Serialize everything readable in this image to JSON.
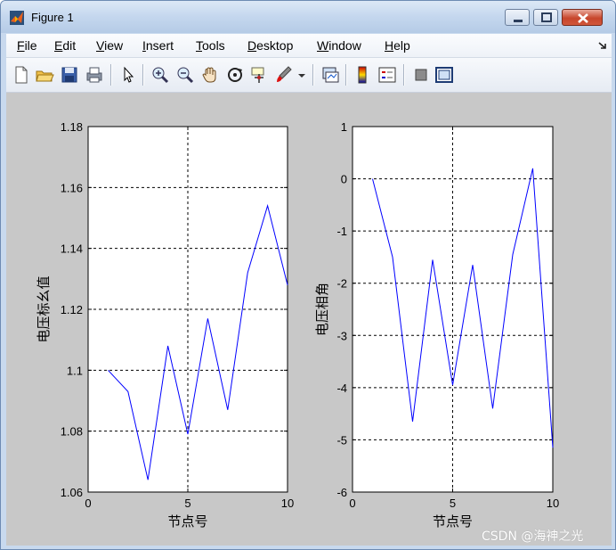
{
  "window": {
    "title": "Figure 1"
  },
  "menu": {
    "items": [
      {
        "label": "File",
        "ul": "F",
        "rest": "ile"
      },
      {
        "label": "Edit",
        "ul": "E",
        "rest": "dit"
      },
      {
        "label": "View",
        "ul": "V",
        "rest": "iew"
      },
      {
        "label": "Insert",
        "ul": "I",
        "rest": "nsert"
      },
      {
        "label": "Tools",
        "ul": "T",
        "rest": "ools"
      },
      {
        "label": "Desktop",
        "ul": "D",
        "rest": "esktop"
      },
      {
        "label": "Window",
        "ul": "W",
        "rest": "indow"
      },
      {
        "label": "Help",
        "ul": "H",
        "rest": "elp"
      }
    ]
  },
  "toolbar": {
    "icons": [
      "new-figure-icon",
      "open-file-icon",
      "save-icon",
      "print-icon",
      "select-arrow-icon",
      "zoom-in-icon",
      "zoom-out-icon",
      "pan-hand-icon",
      "rotate-3d-icon",
      "data-cursor-icon",
      "brush-icon",
      "link-plot-icon",
      "colorbar-icon",
      "legend-icon",
      "hide-plot-tools-icon",
      "show-plot-tools-icon"
    ]
  },
  "watermark": "CSDN @海神之光",
  "colors": {
    "line": "#0000ff",
    "figure_bg": "#c8c8c8",
    "axes_bg": "#ffffff"
  },
  "chart_data": [
    {
      "type": "line",
      "title": "",
      "xlabel": "节点号",
      "ylabel": "电压标幺值",
      "xlim": [
        0,
        10
      ],
      "ylim": [
        1.06,
        1.18
      ],
      "xticks": [
        0,
        5,
        10
      ],
      "xtick_labels": [
        "0",
        "5",
        "10"
      ],
      "yticks": [
        1.06,
        1.08,
        1.1,
        1.12,
        1.14,
        1.16,
        1.18
      ],
      "ytick_labels": [
        "1.06",
        "1.08",
        "1.1",
        "1.12",
        "1.14",
        "1.16",
        "1.18"
      ],
      "grid": true,
      "series": [
        {
          "x": [
            1,
            2,
            3,
            4,
            5,
            6,
            7,
            8,
            9,
            10
          ],
          "y": [
            1.1,
            1.093,
            1.064,
            1.108,
            1.079,
            1.117,
            1.087,
            1.132,
            1.154,
            1.128
          ]
        }
      ]
    },
    {
      "type": "line",
      "title": "",
      "xlabel": "节点号",
      "ylabel": "电压相角",
      "xlim": [
        0,
        10
      ],
      "ylim": [
        -6,
        1
      ],
      "xticks": [
        0,
        5,
        10
      ],
      "xtick_labels": [
        "0",
        "5",
        "10"
      ],
      "yticks": [
        -6,
        -5,
        -4,
        -3,
        -2,
        -1,
        0,
        1
      ],
      "ytick_labels": [
        "-6",
        "-5",
        "-4",
        "-3",
        "-2",
        "-1",
        "0",
        "1"
      ],
      "grid": true,
      "series": [
        {
          "x": [
            1,
            2,
            3,
            4,
            5,
            6,
            7,
            8,
            9,
            10
          ],
          "y": [
            0,
            -1.5,
            -4.65,
            -1.55,
            -3.95,
            -1.65,
            -4.4,
            -1.45,
            0.2,
            -5.15
          ]
        }
      ]
    }
  ]
}
